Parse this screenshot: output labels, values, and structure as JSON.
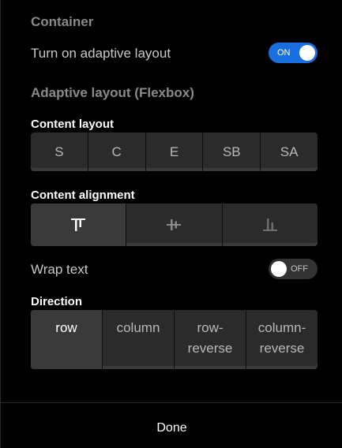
{
  "container": {
    "title": "Container",
    "adaptive_label": "Turn on adaptive layout",
    "adaptive_toggle": "ON"
  },
  "flexbox": {
    "title": "Adaptive layout (Flexbox)",
    "content_layout": {
      "label": "Content layout",
      "options": [
        "S",
        "C",
        "E",
        "SB",
        "SA"
      ]
    },
    "content_alignment": {
      "label": "Content alignment",
      "options": [
        "align-top-icon",
        "align-center-icon",
        "align-bottom-icon"
      ],
      "selected": 0
    },
    "wrap": {
      "label": "Wrap text",
      "toggle": "OFF"
    },
    "direction": {
      "label": "Direction",
      "options": [
        {
          "line1": "row",
          "line2": ""
        },
        {
          "line1": "column",
          "line2": ""
        },
        {
          "line1": "row-",
          "line2": "reverse"
        },
        {
          "line1": "column-",
          "line2": "reverse"
        }
      ],
      "selected": 0
    }
  },
  "footer": {
    "done_label": "Done"
  },
  "colors": {
    "accent": "#1a6fe0",
    "background": "#000000",
    "segment": "#2b2b2b",
    "segment_active": "#3a3a3a"
  }
}
